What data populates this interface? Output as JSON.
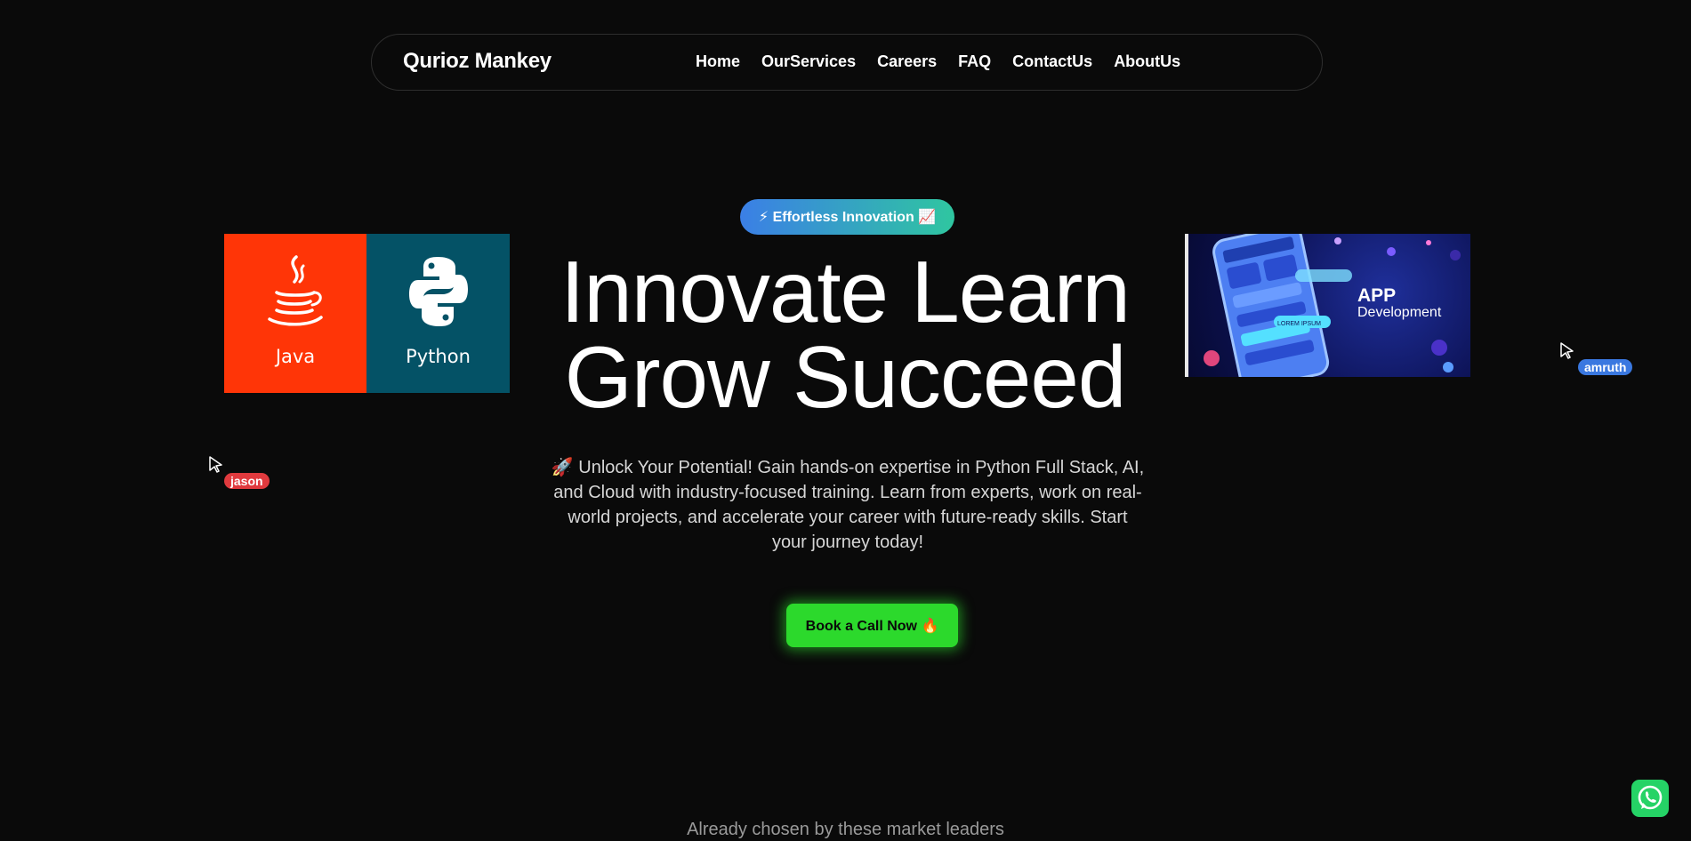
{
  "header": {
    "brand": "Qurioz Mankey",
    "nav": [
      "Home",
      "OurServices",
      "Careers",
      "FAQ",
      "ContactUs",
      "AboutUs"
    ]
  },
  "hero": {
    "badge": "⚡ Effortless Innovation 📈",
    "title_line1": "Innovate Learn",
    "title_line2": "Grow Succeed",
    "description": "🚀 Unlock Your Potential! Gain hands-on expertise in Python Full Stack, AI, and Cloud with industry-focused training. Learn from experts, work on real-world projects, and accelerate your career with future-ready skills. Start your journey today!",
    "cta_label": "Book a Call Now 🔥"
  },
  "tech_tiles": [
    {
      "label": "Java",
      "color": "#ff3507",
      "icon": "java-cup-icon"
    },
    {
      "label": "Python",
      "color": "#045266",
      "icon": "python-logo-icon"
    }
  ],
  "app_banner": {
    "title": "APP",
    "subtitle": "Development",
    "mockup_label": "LOREM IPSUM"
  },
  "collaborators": [
    {
      "name": "jason",
      "color": "#e03a3e"
    },
    {
      "name": "amruth",
      "color": "#3a78e0"
    }
  ],
  "leaders_text": "Already chosen by these market leaders",
  "colors": {
    "background": "#0a0a0a",
    "cta": "#2cd92c",
    "whatsapp": "#25d366"
  }
}
